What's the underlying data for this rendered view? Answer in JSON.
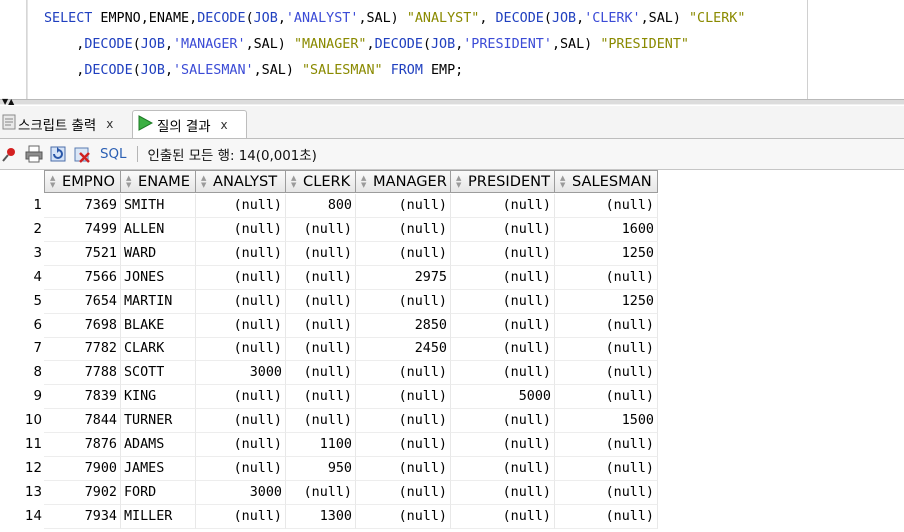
{
  "editor": {
    "lines": [
      [
        {
          "t": "SELECT",
          "c": "kw"
        },
        {
          "t": " EMPNO,ENAME,"
        },
        {
          "t": "DECODE",
          "c": "kw"
        },
        {
          "t": "("
        },
        {
          "t": "JOB",
          "c": "kw"
        },
        {
          "t": ","
        },
        {
          "t": "'ANALYST'",
          "c": "str"
        },
        {
          "t": ",SAL) "
        },
        {
          "t": "\"ANALYST\"",
          "c": "alias"
        },
        {
          "t": ", "
        },
        {
          "t": "DECODE",
          "c": "kw"
        },
        {
          "t": "("
        },
        {
          "t": "JOB",
          "c": "kw"
        },
        {
          "t": ","
        },
        {
          "t": "'CLERK'",
          "c": "str"
        },
        {
          "t": ",SAL) "
        },
        {
          "t": "\"CLERK\"",
          "c": "alias"
        }
      ],
      [
        {
          "t": "    ,"
        },
        {
          "t": "DECODE",
          "c": "kw"
        },
        {
          "t": "("
        },
        {
          "t": "JOB",
          "c": "kw"
        },
        {
          "t": ","
        },
        {
          "t": "'MANAGER'",
          "c": "str"
        },
        {
          "t": ",SAL) "
        },
        {
          "t": "\"MANAGER\"",
          "c": "alias"
        },
        {
          "t": ","
        },
        {
          "t": "DECODE",
          "c": "kw"
        },
        {
          "t": "("
        },
        {
          "t": "JOB",
          "c": "kw"
        },
        {
          "t": ","
        },
        {
          "t": "'PRESIDENT'",
          "c": "str"
        },
        {
          "t": ",SAL) "
        },
        {
          "t": "\"PRESIDENT\"",
          "c": "alias"
        }
      ],
      [
        {
          "t": "    ,"
        },
        {
          "t": "DECODE",
          "c": "kw"
        },
        {
          "t": "("
        },
        {
          "t": "JOB",
          "c": "kw"
        },
        {
          "t": ","
        },
        {
          "t": "'SALESMAN'",
          "c": "str"
        },
        {
          "t": ",SAL) "
        },
        {
          "t": "\"SALESMAN\"",
          "c": "alias"
        },
        {
          "t": " "
        },
        {
          "t": "FROM",
          "c": "kw"
        },
        {
          "t": " EMP;"
        }
      ]
    ]
  },
  "tabs": {
    "script_output": "스크립트 출력",
    "query_result": "질의 결과",
    "close_glyph": "x"
  },
  "toolbar": {
    "sql_label": "SQL",
    "status": "인출된 모든 행: 14(0,001초)"
  },
  "grid": {
    "columns": [
      "EMPNO",
      "ENAME",
      "ANALYST",
      "CLERK",
      "MANAGER",
      "PRESIDENT",
      "SALESMAN"
    ],
    "rows": [
      [
        "1",
        "7369",
        "SMITH",
        "(null)",
        "800",
        "(null)",
        "(null)",
        "(null)"
      ],
      [
        "2",
        "7499",
        "ALLEN",
        "(null)",
        "(null)",
        "(null)",
        "(null)",
        "1600"
      ],
      [
        "3",
        "7521",
        "WARD",
        "(null)",
        "(null)",
        "(null)",
        "(null)",
        "1250"
      ],
      [
        "4",
        "7566",
        "JONES",
        "(null)",
        "(null)",
        "2975",
        "(null)",
        "(null)"
      ],
      [
        "5",
        "7654",
        "MARTIN",
        "(null)",
        "(null)",
        "(null)",
        "(null)",
        "1250"
      ],
      [
        "6",
        "7698",
        "BLAKE",
        "(null)",
        "(null)",
        "2850",
        "(null)",
        "(null)"
      ],
      [
        "7",
        "7782",
        "CLARK",
        "(null)",
        "(null)",
        "2450",
        "(null)",
        "(null)"
      ],
      [
        "8",
        "7788",
        "SCOTT",
        "3000",
        "(null)",
        "(null)",
        "(null)",
        "(null)"
      ],
      [
        "9",
        "7839",
        "KING",
        "(null)",
        "(null)",
        "(null)",
        "5000",
        "(null)"
      ],
      [
        "10",
        "7844",
        "TURNER",
        "(null)",
        "(null)",
        "(null)",
        "(null)",
        "1500"
      ],
      [
        "11",
        "7876",
        "ADAMS",
        "(null)",
        "1100",
        "(null)",
        "(null)",
        "(null)"
      ],
      [
        "12",
        "7900",
        "JAMES",
        "(null)",
        "950",
        "(null)",
        "(null)",
        "(null)"
      ],
      [
        "13",
        "7902",
        "FORD",
        "3000",
        "(null)",
        "(null)",
        "(null)",
        "(null)"
      ],
      [
        "14",
        "7934",
        "MILLER",
        "(null)",
        "1300",
        "(null)",
        "(null)",
        "(null)"
      ]
    ]
  },
  "icons": {
    "pin": "pin-icon",
    "print": "print-icon",
    "refresh": "refresh-icon",
    "clear": "clear-icon",
    "run": "run-icon",
    "script": "script-icon"
  }
}
